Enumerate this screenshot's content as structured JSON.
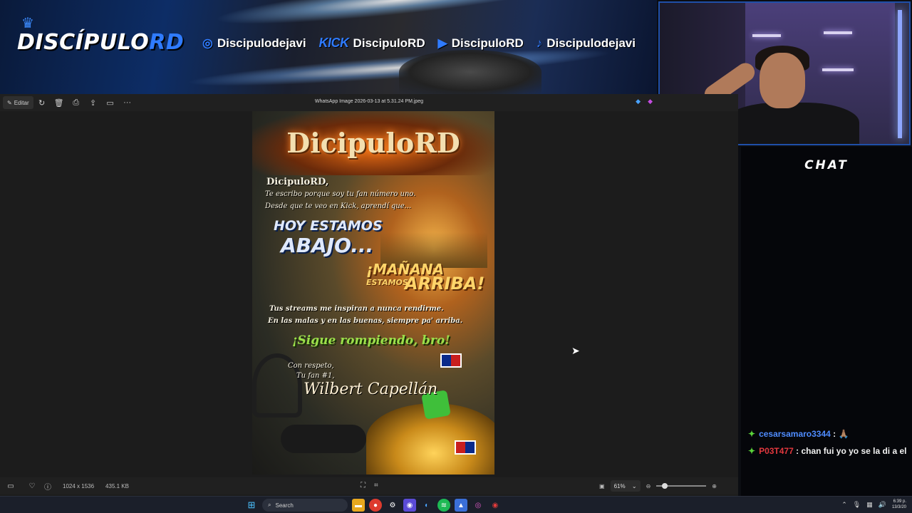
{
  "banner": {
    "brand_main": "DISCÍPULO",
    "brand_accent": "RD",
    "socials": [
      {
        "icon": "instagram-icon",
        "handle": "Discipulodejavi"
      },
      {
        "icon": "kick-logo",
        "label": "KICK",
        "handle": "DiscipuloRD"
      },
      {
        "icon": "youtube-icon",
        "handle": "DiscipuloRD"
      },
      {
        "icon": "tiktok-icon",
        "handle": "Discipulodejavi"
      }
    ]
  },
  "viewer": {
    "edit_label": "Editar",
    "filename": "WhatsApp Image 2026-03-13 at 5.31.24 PM.jpeg",
    "dimensions": "1024 x 1536",
    "file_size": "435.1 KB",
    "zoom": "61%",
    "zoom_fraction": 0.12
  },
  "poster": {
    "title": "DicipuloRD",
    "greeting": "DicipuloRD,",
    "line1": "Te escribo porque soy tu fan número uno.",
    "line2": "Desde que te veo en Kick, aprendí que...",
    "hoy": "HOY ESTAMOS",
    "abajo": "ABAJO...",
    "manana": "¡MAÑANA",
    "estamos": "ESTAMOS",
    "arriba": "ARRIBA!",
    "line3": "Tus streams me inspiran a nunca rendirme.",
    "line4": "En las malas y en las buenas, siempre pa' arriba.",
    "sigue": "¡Sigue rompiendo, bro!",
    "con_respeto": "Con respeto,",
    "tu_fan": "Tu fan #1,",
    "signature": "Wilbert Capellán"
  },
  "chat": {
    "title": "CHAT",
    "messages": [
      {
        "user": "cesarsamaro3344",
        "text": ": 🙏🏽"
      },
      {
        "user": "P03T477",
        "text": ": chan fui yo yo se la di a el"
      }
    ]
  },
  "taskbar": {
    "search_placeholder": "Search",
    "time": "6:39 p.",
    "date": "13/3/20"
  },
  "colors": {
    "brand_blue": "#2f7bff",
    "chat_gem": "#5bd33a",
    "user1": "#4f8cff",
    "user2": "#e3383e"
  }
}
